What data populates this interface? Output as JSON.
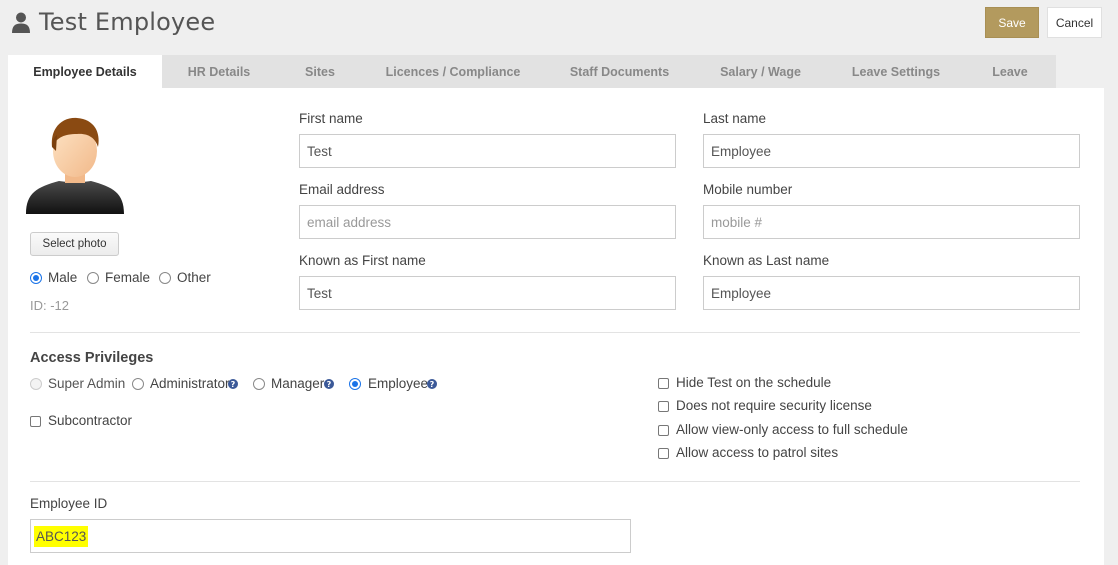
{
  "header": {
    "title": "Test Employee",
    "user_icon": "user-icon",
    "save_label": "Save",
    "cancel_label": "Cancel"
  },
  "tabs": [
    {
      "label": "Employee Details",
      "active": true
    },
    {
      "label": "HR Details"
    },
    {
      "label": "Sites"
    },
    {
      "label": "Licences / Compliance"
    },
    {
      "label": "Staff Documents"
    },
    {
      "label": "Salary / Wage"
    },
    {
      "label": "Leave Settings"
    },
    {
      "label": "Leave"
    }
  ],
  "photo": {
    "select_label": "Select photo",
    "avatar_icon": "avatar-icon"
  },
  "gender": {
    "options": [
      "Male",
      "Female",
      "Other"
    ],
    "selected": "Male"
  },
  "employee_id_display": "ID: -12",
  "fields": {
    "first_name": {
      "label": "First name",
      "value": "Test",
      "placeholder": ""
    },
    "last_name": {
      "label": "Last name",
      "value": "Employee",
      "placeholder": ""
    },
    "email": {
      "label": "Email address",
      "value": "",
      "placeholder": "email address"
    },
    "mobile": {
      "label": "Mobile number",
      "value": "",
      "placeholder": "mobile #"
    },
    "known_first": {
      "label": "Known as First name",
      "value": "Test",
      "placeholder": ""
    },
    "known_last": {
      "label": "Known as Last name",
      "value": "Employee",
      "placeholder": ""
    }
  },
  "access": {
    "title": "Access Privileges",
    "roles": [
      "Super Admin",
      "Administrator",
      "Manager",
      "Employee"
    ],
    "selected_role": "Employee",
    "subcontractor_label": "Subcontractor",
    "options": [
      "Hide Test on the schedule",
      "Does not require security license",
      "Allow view-only access to full schedule",
      "Allow access to patrol sites"
    ]
  },
  "employee_id": {
    "label": "Employee ID",
    "value": "ABC123"
  },
  "colors": {
    "save_bg": "#b39a5e",
    "radio_selected": "#1a73e8",
    "highlight": "#ffff00"
  }
}
